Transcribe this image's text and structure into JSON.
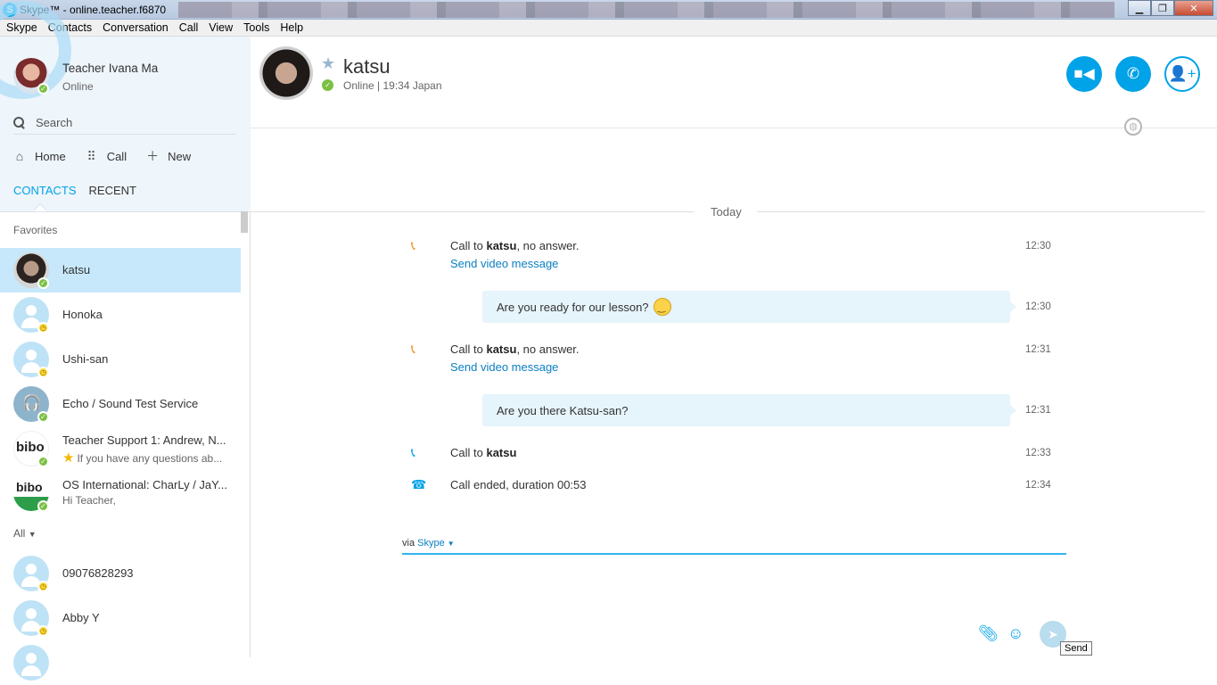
{
  "window": {
    "title": "Skype™ - online.teacher.f6870"
  },
  "menu": [
    "Skype",
    "Contacts",
    "Conversation",
    "Call",
    "View",
    "Tools",
    "Help"
  ],
  "profile": {
    "name": "Teacher Ivana Ma",
    "status": "Online"
  },
  "search": {
    "placeholder": "Search"
  },
  "nav": {
    "home": "Home",
    "call": "Call",
    "new": "New"
  },
  "tabs": {
    "contacts": "CONTACTS",
    "recent": "RECENT"
  },
  "sections": {
    "favorites": "Favorites",
    "all": "All"
  },
  "favorites": [
    {
      "name": "katsu",
      "status": "online"
    },
    {
      "name": "Honoka",
      "status": "away"
    },
    {
      "name": "Ushi-san",
      "status": "away"
    },
    {
      "name": "Echo / Sound Test Service",
      "status": "online"
    },
    {
      "name": "Teacher Support 1: Andrew, N...",
      "mood": "If you have any questions ab...",
      "status": "online"
    },
    {
      "name": "OS International: CharLy / JaY...",
      "mood": "Hi Teacher,",
      "status": "online"
    }
  ],
  "all_contacts": [
    {
      "name": "09076828293",
      "status": "away"
    },
    {
      "name": "Abby Y",
      "status": "away"
    }
  ],
  "conversation": {
    "name": "katsu",
    "status": "Online | 19:34 Japan",
    "day_label": "Today",
    "events": [
      {
        "prefix": "Call to ",
        "bold": "katsu",
        "suffix": ", no answer.",
        "link": "Send video message",
        "time": "12:30"
      },
      {
        "message": "Are you ready for our lesson?",
        "time": "12:30"
      },
      {
        "prefix": "Call to ",
        "bold": "katsu",
        "suffix": ", no answer.",
        "link": "Send video message",
        "time": "12:31"
      },
      {
        "message": "Are you there Katsu-san?",
        "time": "12:31"
      },
      {
        "prefix": "Call to ",
        "bold": "katsu",
        "suffix": "",
        "time": "12:33"
      },
      {
        "text": "Call ended, duration 00:53",
        "time": "12:34"
      }
    ]
  },
  "compose": {
    "via": "via",
    "service": "Skype",
    "send_tooltip": "Send"
  },
  "colors": {
    "accent": "#00a2e8",
    "selected": "#c7e8fa",
    "online": "#7bc043",
    "away": "#fdd835"
  }
}
